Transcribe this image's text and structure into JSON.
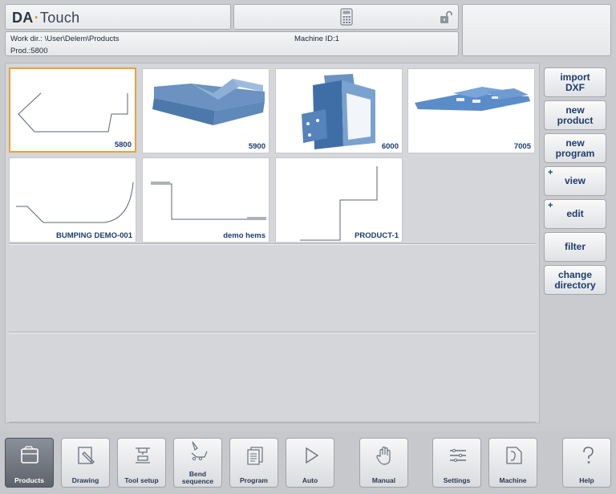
{
  "header": {
    "logo_brand": "DA",
    "logo_dot": "·",
    "logo_product": "Touch"
  },
  "info": {
    "work_dir": "Work dir.: \\User\\Delem\\Products",
    "machine_id": "Machine ID:1",
    "product": "Prod.:5800"
  },
  "products": [
    {
      "label": "5800",
      "selected": true
    },
    {
      "label": "5900",
      "selected": false
    },
    {
      "label": "6000",
      "selected": false
    },
    {
      "label": "7005",
      "selected": false
    },
    {
      "label": "BUMPING DEMO-001",
      "selected": false
    },
    {
      "label": "demo hems",
      "selected": false
    },
    {
      "label": "PRODUCT-1",
      "selected": false
    }
  ],
  "side_buttons": [
    {
      "label": "import DXF",
      "plus": ""
    },
    {
      "label": "new product",
      "plus": ""
    },
    {
      "label": "new program",
      "plus": ""
    },
    {
      "label": "view",
      "plus": "+"
    },
    {
      "label": "edit",
      "plus": "+"
    },
    {
      "label": "filter",
      "plus": ""
    },
    {
      "label": "change directory",
      "plus": ""
    }
  ],
  "tabs": [
    {
      "label": "Products",
      "icon": "folder-icon",
      "active": true
    },
    {
      "label": "Drawing",
      "icon": "drawing-icon",
      "active": false
    },
    {
      "label": "Tool setup",
      "icon": "tool-setup-icon",
      "active": false
    },
    {
      "label": "Bend sequence",
      "icon": "bend-sequence-icon",
      "active": false
    },
    {
      "label": "Program",
      "icon": "program-icon",
      "active": false
    },
    {
      "label": "Auto",
      "icon": "play-icon",
      "active": false
    },
    {
      "label": "Manual",
      "icon": "hand-icon",
      "active": false
    },
    {
      "label": "Settings",
      "icon": "settings-list-icon",
      "active": false
    },
    {
      "label": "Machine",
      "icon": "machine-icon",
      "active": false
    },
    {
      "label": "Help",
      "icon": "help-icon",
      "active": false
    }
  ],
  "colors": {
    "accent_selected": "#e8a23a",
    "label_blue": "#1d3b6e",
    "part_blue": "#4a86c8"
  }
}
